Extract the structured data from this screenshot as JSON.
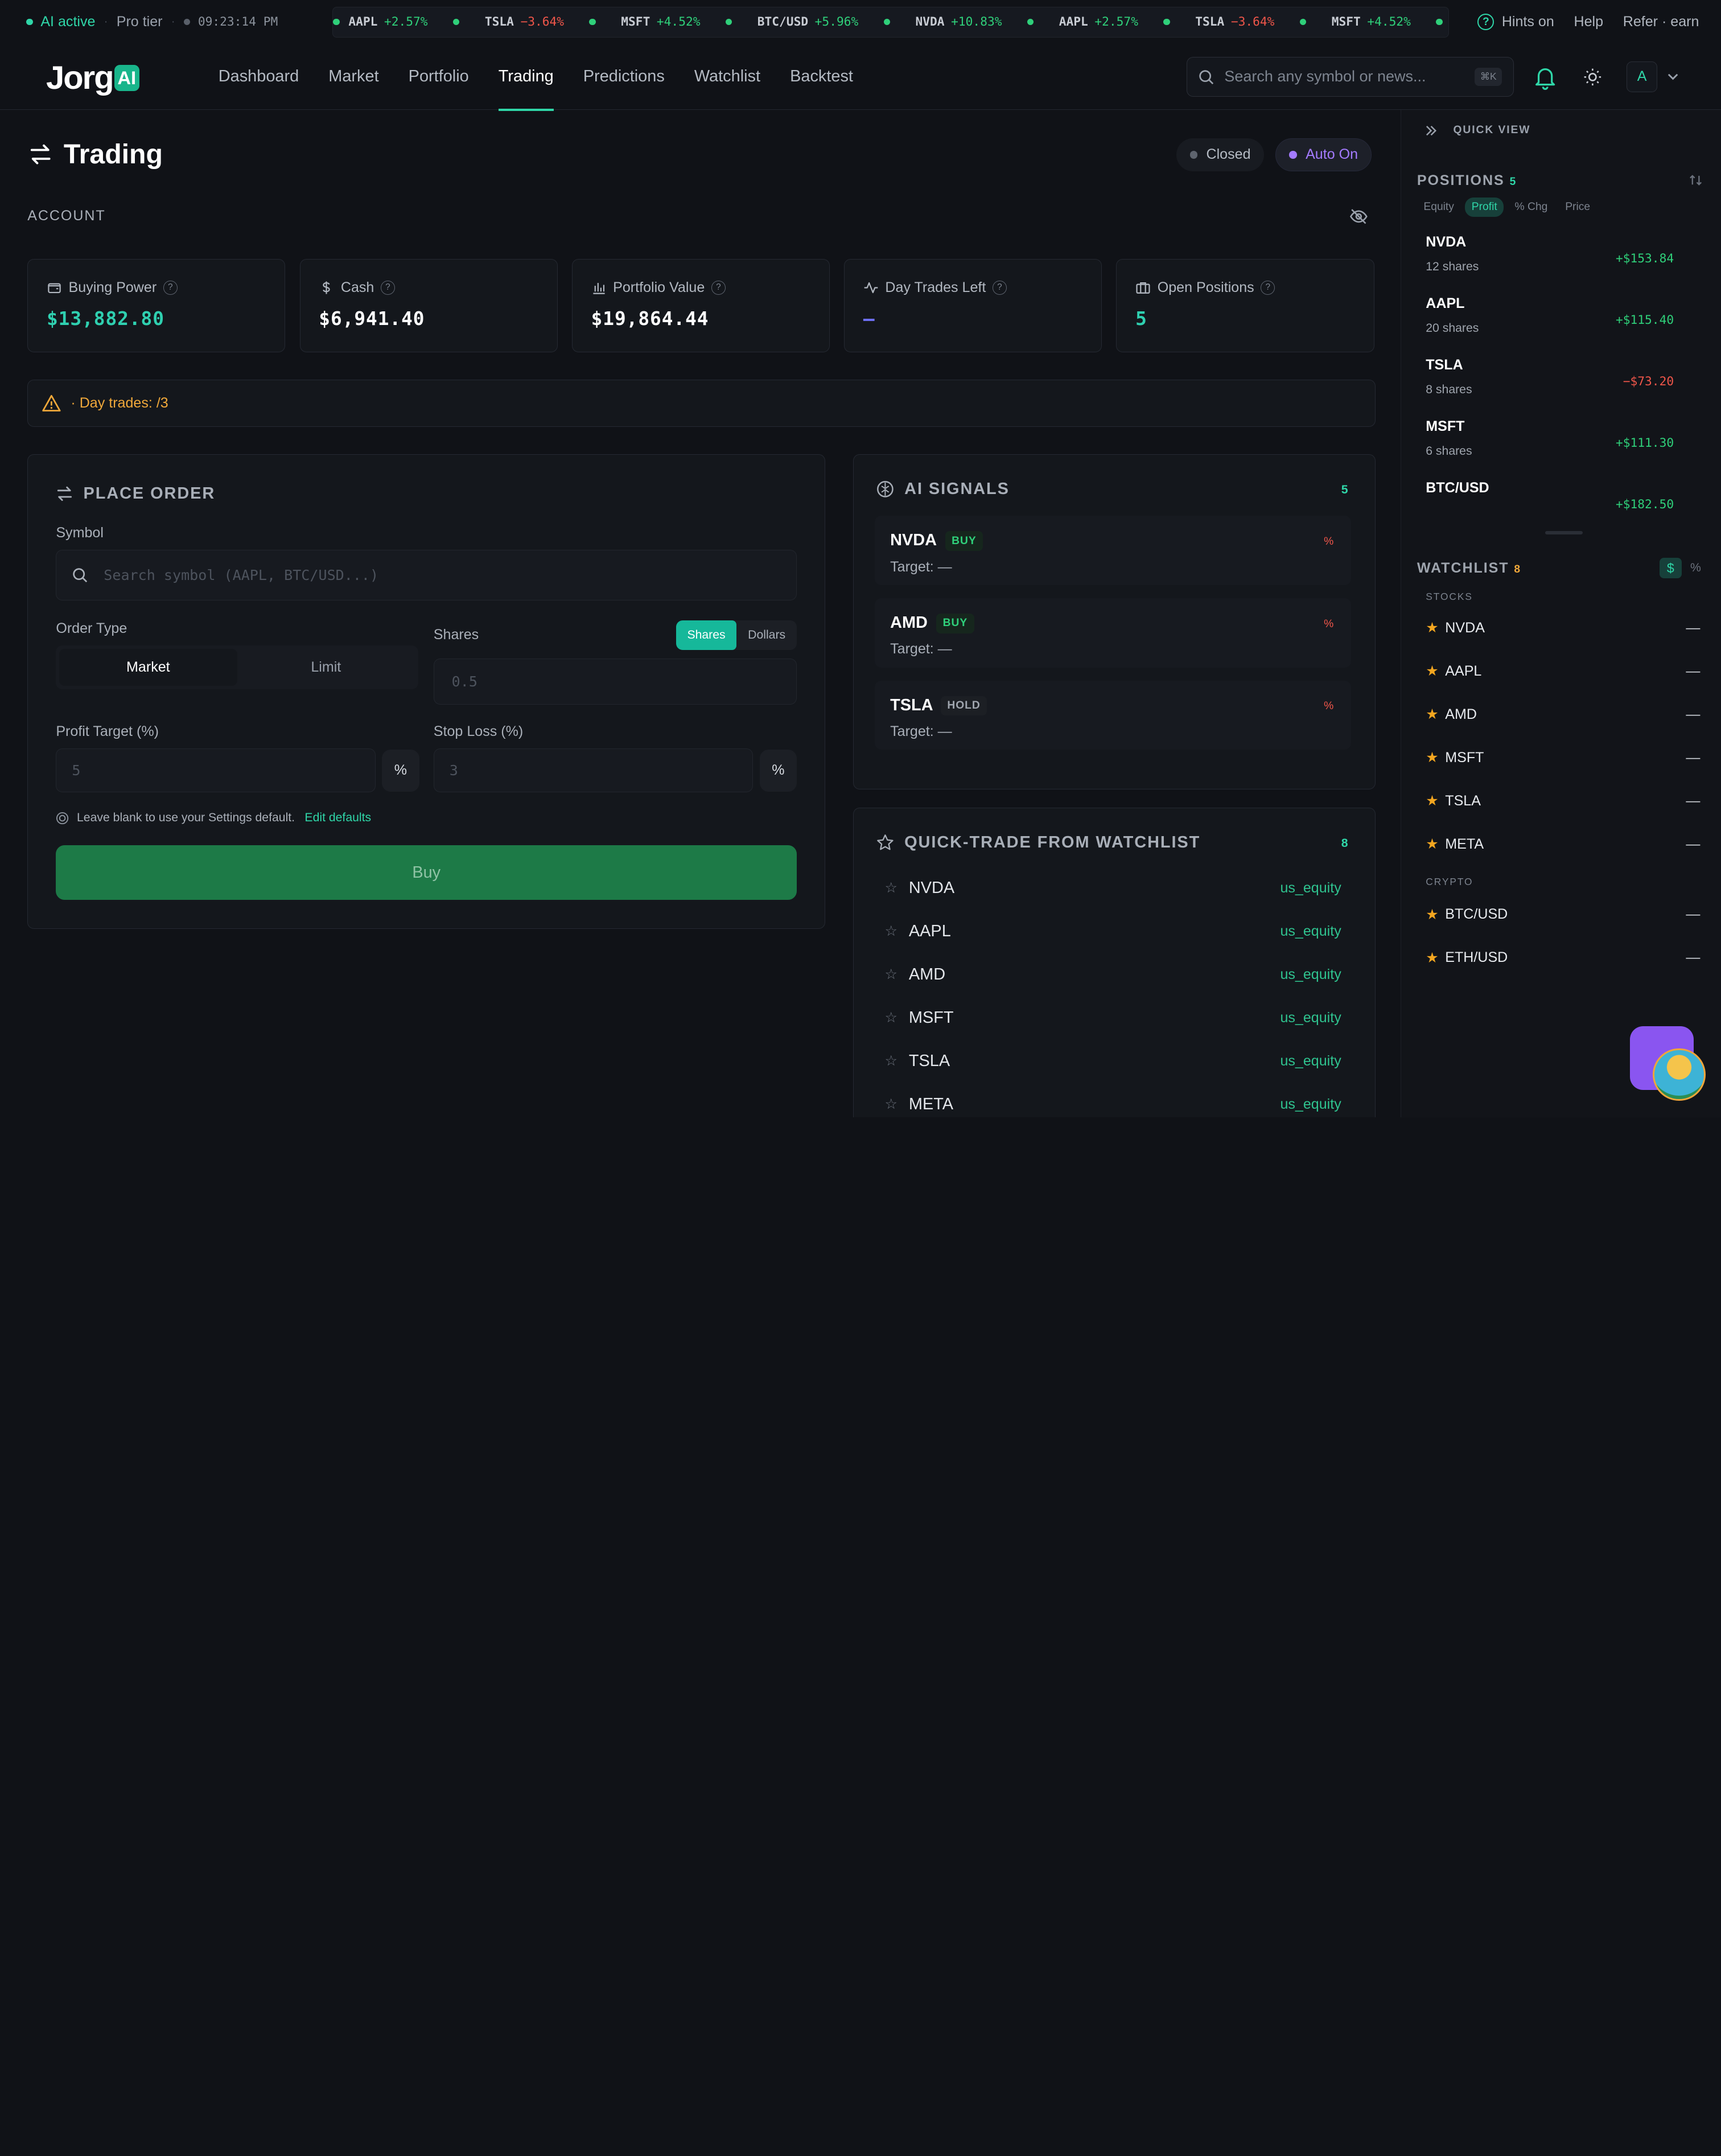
{
  "status_bar": {
    "ai_status": "AI active",
    "tier": "Pro tier",
    "time": "09:23:14 PM",
    "ticker": [
      {
        "symbol": "AAPL",
        "change": "+2.57%",
        "direction": "up"
      },
      {
        "symbol": "TSLA",
        "change": "−3.64%",
        "direction": "down"
      },
      {
        "symbol": "MSFT",
        "change": "+4.52%",
        "direction": "up"
      },
      {
        "symbol": "BTC/USD",
        "change": "+5.96%",
        "direction": "up"
      },
      {
        "symbol": "NVDA",
        "change": "+10.83%",
        "direction": "up"
      },
      {
        "symbol": "AAPL",
        "change": "+2.57%",
        "direction": "up"
      },
      {
        "symbol": "TSLA",
        "change": "−3.64%",
        "direction": "down"
      },
      {
        "symbol": "MSFT",
        "change": "+4.52%",
        "direction": "up"
      }
    ],
    "hints": "Hints on",
    "help": "Help",
    "refer": "Refer · earn"
  },
  "nav": {
    "logo_text": "Jorg",
    "logo_badge": "AI",
    "links": [
      "Dashboard",
      "Market",
      "Portfolio",
      "Trading",
      "Predictions",
      "Watchlist",
      "Backtest"
    ],
    "active_link": "Trading",
    "search_placeholder": "Search any symbol or news...",
    "search_shortcut": "⌘K",
    "avatar_initial": "A"
  },
  "page": {
    "title": "Trading",
    "market_status": "Closed",
    "auto_status": "Auto On",
    "account_label": "ACCOUNT"
  },
  "account_cards": [
    {
      "label": "Buying Power",
      "value": "$13,882.80",
      "icon": "wallet-icon",
      "value_color": "#2fd0b0"
    },
    {
      "label": "Cash",
      "value": "$6,941.40",
      "icon": "dollar-icon",
      "value_color": "#ffffff"
    },
    {
      "label": "Portfolio Value",
      "value": "$19,864.44",
      "icon": "bar-chart-icon",
      "value_color": "#ffffff"
    },
    {
      "label": "Day Trades Left",
      "value": "—",
      "icon": "activity-icon",
      "value_color": "#6d6ff5"
    },
    {
      "label": "Open Positions",
      "value": "5",
      "icon": "briefcase-icon",
      "value_color": "#2fd0b0"
    }
  ],
  "alert": {
    "text": "· Day trades: /3"
  },
  "place_order": {
    "title": "PLACE ORDER",
    "symbol_label": "Symbol",
    "symbol_placeholder": "Search symbol (AAPL, BTC/USD...)",
    "order_type_label": "Order Type",
    "order_types": [
      "Market",
      "Limit"
    ],
    "selected_order_type": "Market",
    "shares_label": "Shares",
    "unit_toggle": [
      "Shares",
      "Dollars"
    ],
    "selected_unit": "Shares",
    "shares_placeholder": "0.5",
    "profit_target_label": "Profit Target (%)",
    "profit_target_placeholder": "5",
    "stop_loss_label": "Stop Loss (%)",
    "stop_loss_placeholder": "3",
    "percent_symbol": "%",
    "hint_text": "Leave blank to use your Settings default.",
    "edit_defaults": "Edit defaults",
    "buy_label": "Buy"
  },
  "ai_signals": {
    "title": "AI SIGNALS",
    "count": "5",
    "items": [
      {
        "symbol": "NVDA",
        "action": "BUY",
        "target": "Target: —",
        "pct": "%"
      },
      {
        "symbol": "AMD",
        "action": "BUY",
        "target": "Target: —",
        "pct": "%"
      },
      {
        "symbol": "TSLA",
        "action": "HOLD",
        "target": "Target: —",
        "pct": "%"
      }
    ]
  },
  "quick_trade": {
    "title": "QUICK-TRADE FROM WATCHLIST",
    "count": "8",
    "items": [
      {
        "symbol": "NVDA",
        "class": "us_equity"
      },
      {
        "symbol": "AAPL",
        "class": "us_equity"
      },
      {
        "symbol": "AMD",
        "class": "us_equity"
      },
      {
        "symbol": "MSFT",
        "class": "us_equity"
      },
      {
        "symbol": "TSLA",
        "class": "us_equity"
      },
      {
        "symbol": "META",
        "class": "us_equity"
      }
    ]
  },
  "quick_view": {
    "title": "QUICK VIEW",
    "positions_title": "POSITIONS",
    "positions_count": "5",
    "sort_tabs": [
      "Equity",
      "Profit",
      "% Chg",
      "Price"
    ],
    "active_sort": "Profit",
    "positions": [
      {
        "symbol": "NVDA",
        "shares": "12 shares",
        "pl": "+$153.84",
        "direction": "up"
      },
      {
        "symbol": "AAPL",
        "shares": "20 shares",
        "pl": "+$115.40",
        "direction": "up"
      },
      {
        "symbol": "TSLA",
        "shares": "8 shares",
        "pl": "−$73.20",
        "direction": "down"
      },
      {
        "symbol": "MSFT",
        "shares": "6 shares",
        "pl": "+$111.30",
        "direction": "up"
      },
      {
        "symbol": "BTC/USD",
        "shares": "",
        "pl": "+$182.50",
        "direction": "up"
      }
    ],
    "watchlist_title": "WATCHLIST",
    "watchlist_count": "8",
    "dollar_toggle": "$",
    "percent_toggle": "%",
    "stocks_label": "STOCKS",
    "stocks": [
      {
        "symbol": "NVDA",
        "value": "—"
      },
      {
        "symbol": "AAPL",
        "value": "—"
      },
      {
        "symbol": "AMD",
        "value": "—"
      },
      {
        "symbol": "MSFT",
        "value": "—"
      },
      {
        "symbol": "TSLA",
        "value": "—"
      },
      {
        "symbol": "META",
        "value": "—"
      }
    ],
    "crypto_label": "CRYPTO",
    "crypto": [
      {
        "symbol": "BTC/USD",
        "value": "—"
      },
      {
        "symbol": "ETH/USD",
        "value": "—"
      }
    ]
  },
  "colors": {
    "accent": "#2fd6a8",
    "positive": "#2fd07a",
    "negative": "#f0564a",
    "warning": "#f0a83a",
    "auto_purple": "#a47bff",
    "buy_button": "#1d7a47"
  }
}
